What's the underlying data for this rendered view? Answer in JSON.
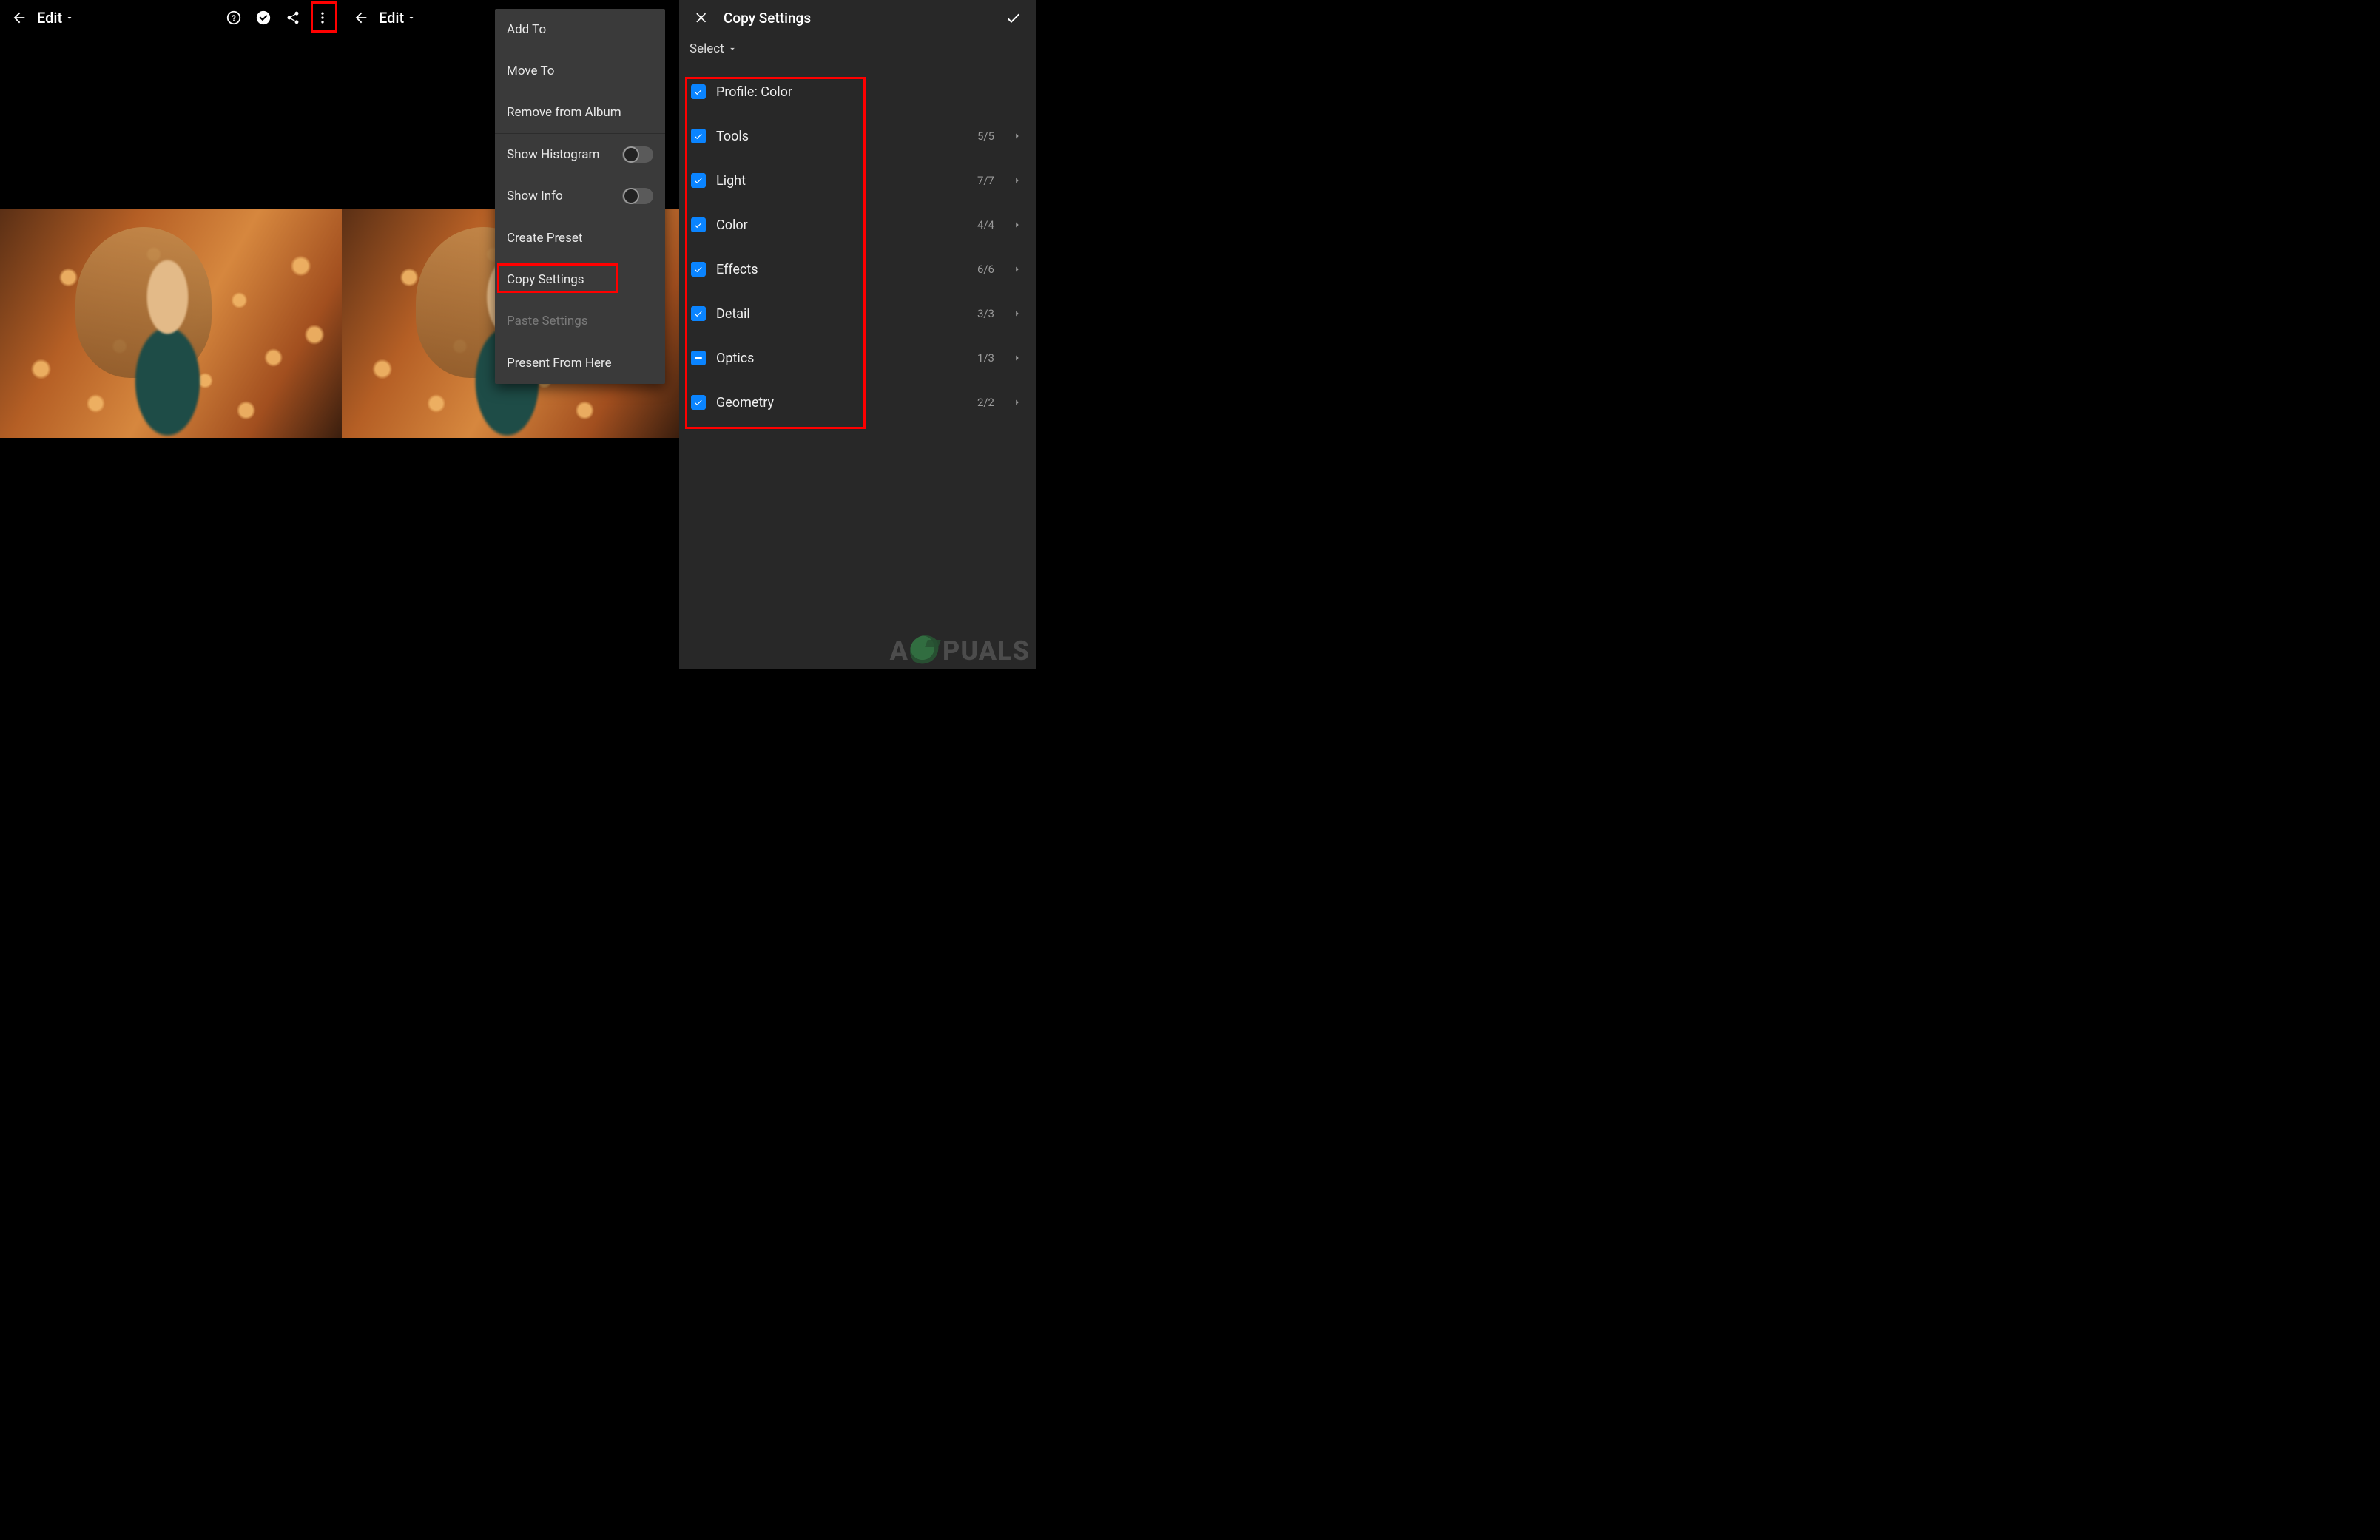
{
  "panel1": {
    "edit_label": "Edit"
  },
  "panel2": {
    "edit_label": "Edit"
  },
  "menu": {
    "items": [
      {
        "label": "Add To",
        "type": "item"
      },
      {
        "label": "Move To",
        "type": "item"
      },
      {
        "label": "Remove from Album",
        "type": "item"
      },
      {
        "label": "Show Histogram",
        "type": "toggle"
      },
      {
        "label": "Show Info",
        "type": "toggle"
      },
      {
        "label": "Create Preset",
        "type": "item"
      },
      {
        "label": "Copy Settings",
        "type": "item",
        "highlight": true
      },
      {
        "label": "Paste Settings",
        "type": "item",
        "disabled": true
      },
      {
        "label": "Present From Here",
        "type": "item"
      }
    ]
  },
  "panel3": {
    "title": "Copy Settings",
    "select_label": "Select",
    "rows": [
      {
        "label": "Profile: Color",
        "checked": true,
        "partial": false,
        "count": "",
        "expandable": false
      },
      {
        "label": "Tools",
        "checked": true,
        "partial": false,
        "count": "5/5",
        "expandable": true
      },
      {
        "label": "Light",
        "checked": true,
        "partial": false,
        "count": "7/7",
        "expandable": true
      },
      {
        "label": "Color",
        "checked": true,
        "partial": false,
        "count": "4/4",
        "expandable": true
      },
      {
        "label": "Effects",
        "checked": true,
        "partial": false,
        "count": "6/6",
        "expandable": true
      },
      {
        "label": "Detail",
        "checked": true,
        "partial": false,
        "count": "3/3",
        "expandable": true
      },
      {
        "label": "Optics",
        "checked": true,
        "partial": true,
        "count": "1/3",
        "expandable": true
      },
      {
        "label": "Geometry",
        "checked": true,
        "partial": false,
        "count": "2/2",
        "expandable": true
      }
    ]
  },
  "watermark": {
    "text_left": "A",
    "text_right": "PUALS"
  }
}
